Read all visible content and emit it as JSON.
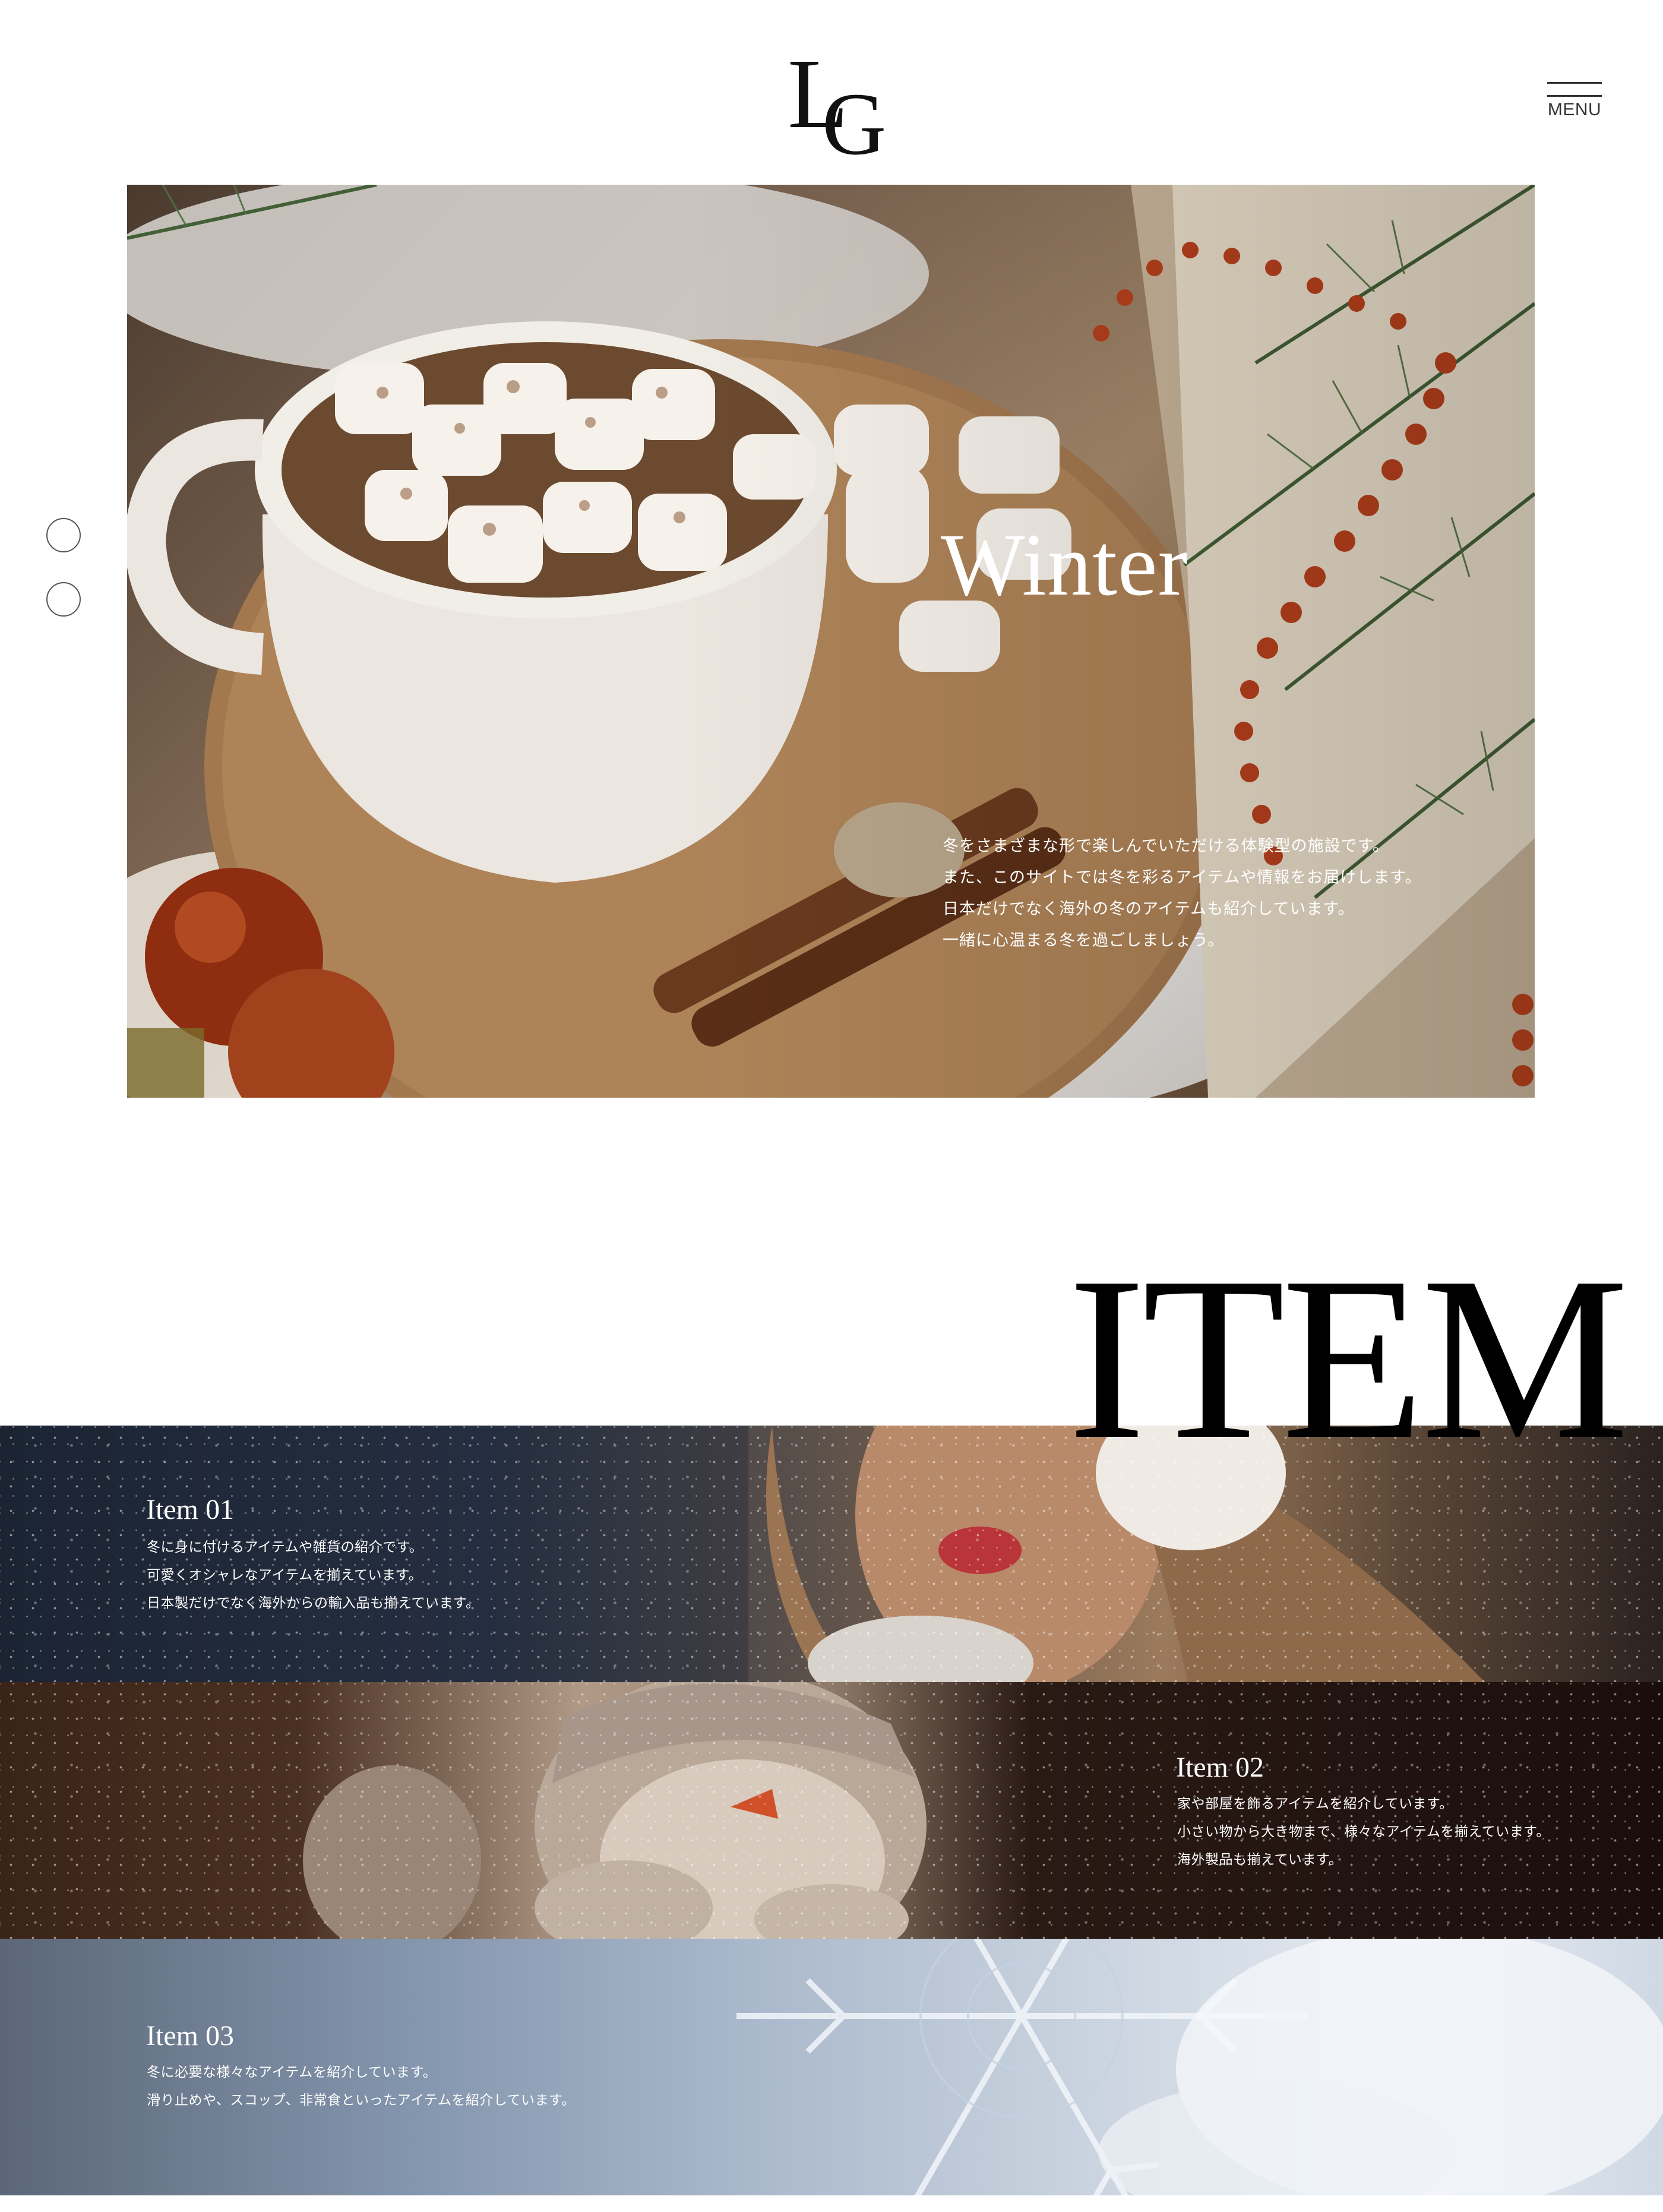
{
  "header": {
    "logo_first": "L",
    "logo_second": "G",
    "menu_label": "MENU"
  },
  "hero": {
    "title": "Winter",
    "lines": [
      "冬をさまざまな形で楽しんでいただける体験型の施設です。",
      "また、このサイトでは冬を彩るアイテムや情報をお届けします。",
      "日本だけでなく海外の冬のアイテムも紹介しています。",
      "一緒に心温まる冬を過ごしましょう。"
    ]
  },
  "slider": {
    "dots": 2
  },
  "items_section": {
    "heading": "ITEM",
    "items": [
      {
        "title": "Item 01",
        "lines": [
          "冬に身に付けるアイテムや雑貨の紹介です。",
          "可愛くオシャレなアイテムを揃えています。",
          "日本製だけでなく海外からの輸入品も揃えています。"
        ]
      },
      {
        "title": "Item 02",
        "lines": [
          "家や部屋を飾るアイテムを紹介しています。",
          "小さい物から大き物まで、様々なアイテムを揃えています。",
          "海外製品も揃えています。"
        ]
      },
      {
        "title": "Item 03",
        "lines": [
          "冬に必要な様々なアイテムを紹介しています。",
          "滑り止めや、スコップ、非常食といったアイテムを紹介しています。"
        ]
      }
    ]
  }
}
